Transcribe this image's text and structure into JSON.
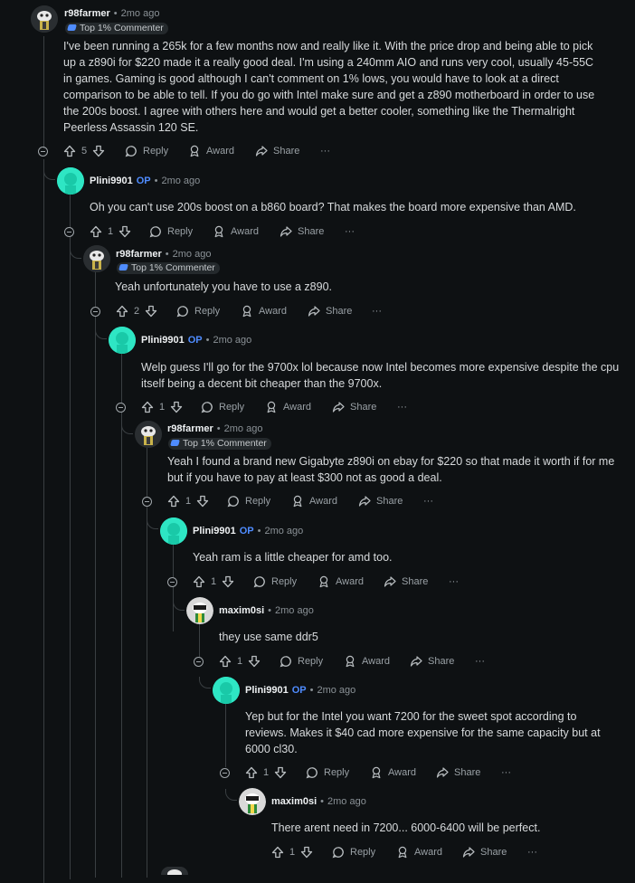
{
  "comments": [
    {
      "user": "r98farmer",
      "op": "",
      "time": "2mo ago",
      "badge": "Top 1% Commenter",
      "votes": "5",
      "body": "I've been running a 265k for a few months now and really like it. With the price drop and being able to pick up a z890i for $220 made it a really good deal. I'm using a 240mm AIO and runs very cool, usually 45-55C in games. Gaming is good although I can't comment on 1% lows, you would have to look at a direct comparison to be able to tell. If you do go with Intel make sure and get a z890 motherboard in order to use the 200s boost. I agree with others here and would get a better cooler, something like the Thermalright Peerless Assassin 120 SE."
    },
    {
      "user": "Plini9901",
      "op": "OP",
      "time": "2mo ago",
      "badge": "",
      "votes": "1",
      "body": "Oh you can't use 200s boost on a b860 board? That makes the board more expensive than AMD."
    },
    {
      "user": "r98farmer",
      "op": "",
      "time": "2mo ago",
      "badge": "Top 1% Commenter",
      "votes": "2",
      "body": "Yeah unfortunately you have to use a z890."
    },
    {
      "user": "Plini9901",
      "op": "OP",
      "time": "2mo ago",
      "badge": "",
      "votes": "1",
      "body": "Welp guess I'll go for the 9700x lol because now Intel becomes more expensive despite the cpu itself being a decent bit cheaper than the 9700x."
    },
    {
      "user": "r98farmer",
      "op": "",
      "time": "2mo ago",
      "badge": "Top 1% Commenter",
      "votes": "1",
      "body": "Yeah I found a brand new Gigabyte z890i on ebay for $220 so that made it worth if for me but if you have to pay at least $300 not as good a deal."
    },
    {
      "user": "Plini9901",
      "op": "OP",
      "time": "2mo ago",
      "badge": "",
      "votes": "1",
      "body": "Yeah ram is a little cheaper for amd too."
    },
    {
      "user": "maxim0si",
      "op": "",
      "time": "2mo ago",
      "badge": "",
      "votes": "1",
      "body": "they use same ddr5"
    },
    {
      "user": "Plini9901",
      "op": "OP",
      "time": "2mo ago",
      "badge": "",
      "votes": "1",
      "body": "Yep but for the Intel you want 7200 for the sweet spot according to reviews. Makes it $40 cad more expensive for the same capacity but at 6000 cl30."
    },
    {
      "user": "maxim0si",
      "op": "",
      "time": "2mo ago",
      "badge": "",
      "votes": "1",
      "body": "There arent need in 7200... 6000-6400 will be perfect."
    }
  ],
  "actions": {
    "reply": "Reply",
    "award": "Award",
    "share": "Share",
    "more": "···"
  },
  "colors": {
    "background": "#0e1113",
    "op": "#4f8cff",
    "teal_avatar": "#2ee6c4",
    "thread_line": "#3a3f42"
  },
  "icons": [
    "upvote-icon",
    "downvote-icon",
    "reply-icon",
    "award-icon",
    "share-icon",
    "more-icon",
    "collapse-icon",
    "avatar-icon",
    "badge-icon"
  ]
}
